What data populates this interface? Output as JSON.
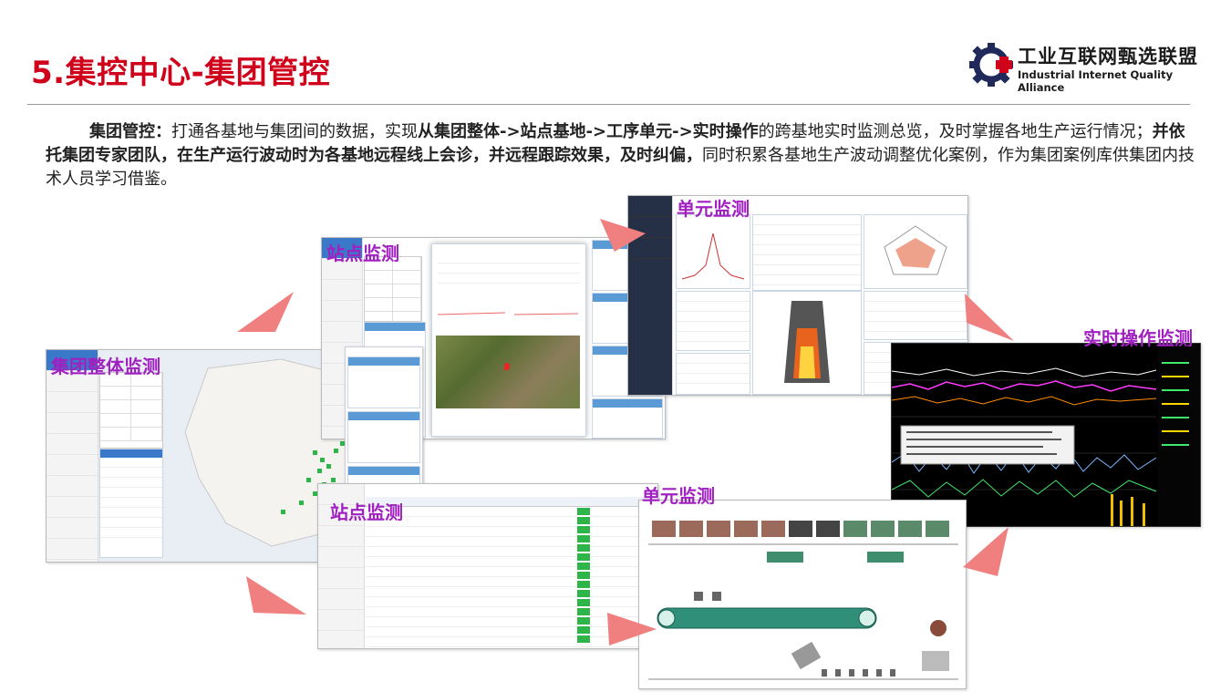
{
  "page": {
    "title": "5.集控中心-集团管控"
  },
  "logo": {
    "name_cn": "工业互联网甄选联盟",
    "name_en": "Industrial Internet Quality Alliance"
  },
  "intro": {
    "lead": "集团管控：",
    "t1": "打通各基地与集团间的数据，实现",
    "b1": "从集团整体->站点基地->工序单元->实时操作",
    "t2": "的跨基地实时监测总览，及时掌握各地生产运行情况；",
    "b2": "并依托集团专家团队，在生产运行波动时为各基地远程线上会诊，并远程跟踪效果，及时纠偏，",
    "t3": "同时积累各基地生产波动调整优化案例，作为集团案例库供集团内技术人员学习借鉴。"
  },
  "labels": {
    "group": "集团整体监测",
    "site_top": "站点监测",
    "site_bottom": "站点监测",
    "unit_top": "单元监测",
    "unit_bottom": "单元监测",
    "realtime": "实时操作监测"
  },
  "colors": {
    "title_red": "#d0021b",
    "label_purple": "#a020c0",
    "arrow_red": "#f08080",
    "accent_blue": "#3a78c9"
  }
}
